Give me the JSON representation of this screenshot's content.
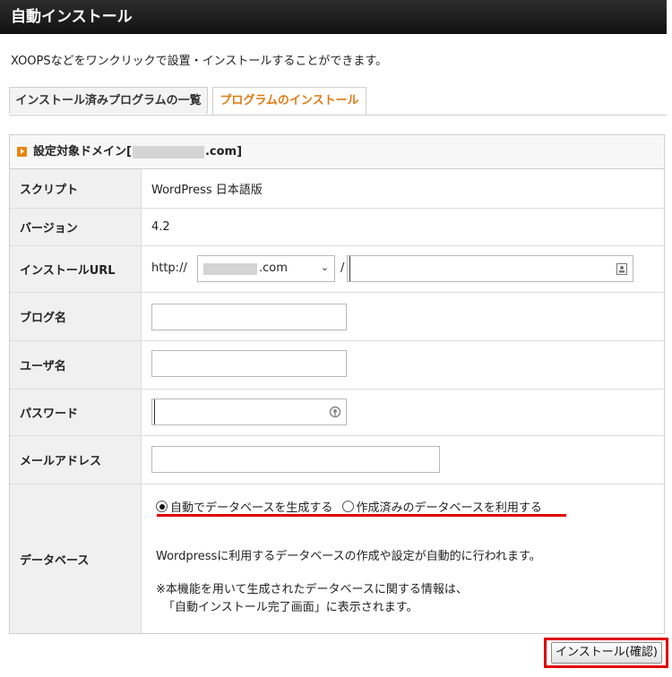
{
  "header": {
    "title": "自動インストール"
  },
  "description": "XOOPSなどをワンクリックで設置・インストールすることができます。",
  "tabs": [
    {
      "label": "インストール済みプログラムの一覧"
    },
    {
      "label": "プログラムのインストール"
    }
  ],
  "panel": {
    "heading_prefix": "設定対象ドメイン[",
    "heading_suffix": ".com]"
  },
  "form": {
    "script": {
      "label": "スクリプト",
      "value": "WordPress 日本語版"
    },
    "version": {
      "label": "バージョン",
      "value": "4.2"
    },
    "install_url": {
      "label": "インストールURL",
      "protocol": "http://",
      "domain_suffix": ".com",
      "separator": "/",
      "path_value": ""
    },
    "blog_name": {
      "label": "ブログ名",
      "value": ""
    },
    "username": {
      "label": "ユーザ名",
      "value": ""
    },
    "password": {
      "label": "パスワード",
      "value": ""
    },
    "email": {
      "label": "メールアドレス",
      "value": ""
    },
    "database": {
      "label": "データベース",
      "option_auto": "自動でデータベースを生成する",
      "option_existing": "作成済みのデータベースを利用する",
      "selected": "auto",
      "note1": "Wordpressに利用するデータベースの作成や設定が自動的に行われます。",
      "note2": "※本機能を用いて生成されたデータベースに関する情報は、",
      "note3": "「自動インストール完了画面」に表示されます。"
    }
  },
  "actions": {
    "confirm_label": "インストール(確認)"
  },
  "colors": {
    "accent": "#e07a12",
    "highlight": "#e00000",
    "header_bg": "#1a1a1a"
  }
}
